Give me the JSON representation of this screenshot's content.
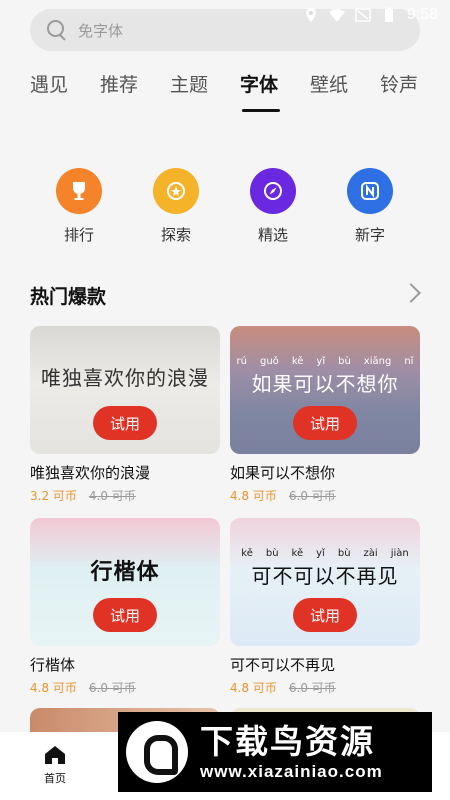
{
  "status_bar": {
    "time": "9:58"
  },
  "search": {
    "placeholder": "免字体"
  },
  "tabs": [
    {
      "label": "遇见",
      "active": false
    },
    {
      "label": "推荐",
      "active": false
    },
    {
      "label": "主题",
      "active": false
    },
    {
      "label": "字体",
      "active": true
    },
    {
      "label": "壁纸",
      "active": false
    },
    {
      "label": "铃声",
      "active": false
    }
  ],
  "quick_links": [
    {
      "label": "排行",
      "icon": "trophy-icon",
      "color": "#f5832a"
    },
    {
      "label": "探索",
      "icon": "star-badge-icon",
      "color": "#f5b32a"
    },
    {
      "label": "精选",
      "icon": "compass-icon",
      "color": "#6a28e0"
    },
    {
      "label": "新字",
      "icon": "new-n-icon",
      "color": "#2f6fe4"
    }
  ],
  "section": {
    "title": "热门爆款"
  },
  "cards": [
    {
      "name": "唯独喜欢你的浪漫",
      "preview": "唯独喜欢你的浪漫",
      "price": "3.2 可币",
      "old_price": "4.0 可币",
      "button": "试用"
    },
    {
      "name": "如果可以不想你",
      "preview": "如果可以不想你",
      "pinyin": [
        "rú",
        "guǒ",
        "kě",
        "yǐ",
        "bù",
        "xiǎng",
        "nǐ"
      ],
      "price": "4.8 可币",
      "old_price": "6.0 可币",
      "button": "试用"
    },
    {
      "name": "行楷体",
      "preview": "行楷体",
      "price": "4.8 可币",
      "old_price": "6.0 可币",
      "button": "试用"
    },
    {
      "name": "可不可以不再见",
      "preview": "可不可以不再见",
      "pinyin": [
        "kě",
        "bù",
        "kě",
        "yǐ",
        "bù",
        "zài",
        "jiàn"
      ],
      "price": "4.8 可币",
      "old_price": "6.0 可币",
      "button": "试用"
    }
  ],
  "bottom_nav": {
    "home_label": "首页"
  },
  "watermark": {
    "title": "下载鸟资源",
    "url": "www.xiazainiao.com"
  }
}
